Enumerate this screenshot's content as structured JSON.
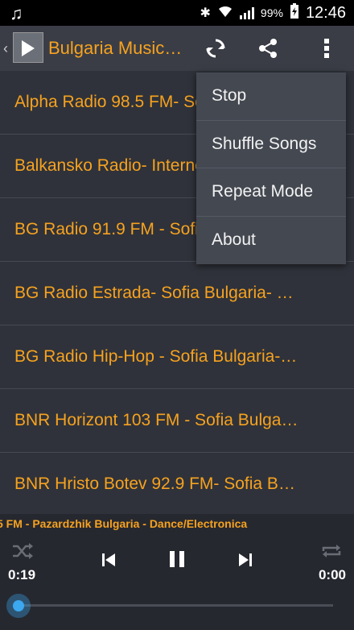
{
  "status_bar": {
    "music_icon": "music-note-icon",
    "battery_percent": "99%",
    "time": "12:46"
  },
  "action_bar": {
    "title": "Bulgaria Music…",
    "icons": [
      "refresh-icon",
      "share-icon",
      "more-vert-icon"
    ]
  },
  "stations": [
    "Alpha Radio 98.5 FM- Sofia Bulgaria",
    "Balkansko Radio- Internet Bulgaria",
    "BG Radio 91.9 FM - Sofia Bulgaria",
    "BG Radio Estrada- Sofia Bulgaria- …",
    "BG Radio Hip-Hop - Sofia Bulgaria-…",
    "BNR Horizont 103 FM - Sofia Bulga…",
    "BNR Hristo Botev 92.9 FM- Sofia B…"
  ],
  "menu": {
    "items": [
      "Stop",
      "Shuffle Songs",
      "Repeat Mode",
      "About"
    ]
  },
  "player": {
    "now_playing": "5 FM -  Pazardzhik Bulgaria -  Dance/Electronica",
    "current_time": "0:19",
    "duration": "0:00",
    "progress": 0.0,
    "accent_color": "#3ca8ef"
  },
  "colors": {
    "orange": "#f6a21f",
    "background": "#2f323a"
  }
}
